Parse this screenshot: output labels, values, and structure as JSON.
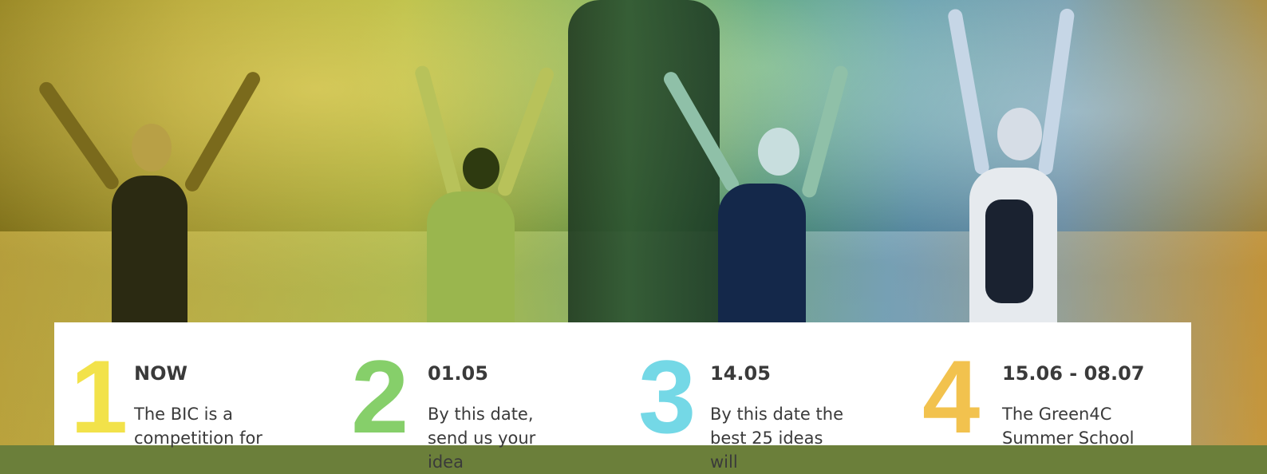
{
  "colors": {
    "step1": "#f2e24a",
    "step2": "#86cf6a",
    "step3": "#74d8e6",
    "step4": "#f2c24e",
    "text": "#3a3a3a",
    "card": "#ffffff"
  },
  "hero": {
    "image_alt": "People exercising with raised arms in a park"
  },
  "timeline": {
    "steps": [
      {
        "number": "1",
        "date": "NOW",
        "text": "The BIC is a competition for"
      },
      {
        "number": "2",
        "date": "01.05",
        "text": "By this date, send us your idea"
      },
      {
        "number": "3",
        "date": "14.05",
        "text": "By this date the best 25 ideas will"
      },
      {
        "number": "4",
        "date": "15.06 - 08.07",
        "text": "The Green4C Summer School"
      }
    ]
  }
}
